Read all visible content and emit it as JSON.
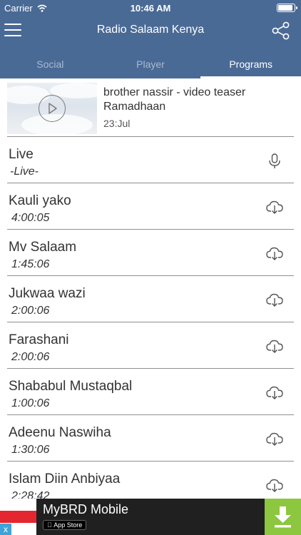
{
  "status_bar": {
    "carrier": "Carrier",
    "time": "10:46 AM"
  },
  "header": {
    "title": "Radio Salaam Kenya"
  },
  "tabs": [
    {
      "label": "Social",
      "active": false
    },
    {
      "label": "Player",
      "active": false
    },
    {
      "label": "Programs",
      "active": true
    }
  ],
  "featured": {
    "title": "brother nassir - video teaser Ramadhaan",
    "date": "23:Jul"
  },
  "programs": [
    {
      "title": "Live",
      "subtitle": "-Live-",
      "icon": "microphone-icon"
    },
    {
      "title": "Kauli yako",
      "subtitle": "4:00:05",
      "icon": "cloud-download-icon"
    },
    {
      "title": "Mv Salaam",
      "subtitle": "1:45:06",
      "icon": "cloud-download-icon"
    },
    {
      "title": "Jukwaa wazi",
      "subtitle": "2:00:06",
      "icon": "cloud-download-icon"
    },
    {
      "title": "Farashani",
      "subtitle": "2:00:06",
      "icon": "cloud-download-icon"
    },
    {
      "title": "Shababul Mustaqbal",
      "subtitle": "1:00:06",
      "icon": "cloud-download-icon"
    },
    {
      "title": "Adeenu Naswiha",
      "subtitle": "1:30:06",
      "icon": "cloud-download-icon"
    },
    {
      "title": "Islam Diin Anbiyaa",
      "subtitle": "2:28:42",
      "icon": "cloud-download-icon"
    }
  ],
  "ad": {
    "title": "MyBRD Mobile",
    "badge": "App Store",
    "close": "x"
  },
  "colors": {
    "header": "#4a6a96",
    "tab_inactive": "#a9b9d2",
    "ad_bg": "#202020",
    "ad_download": "#8dc63f",
    "ad_red": "#e3262f"
  }
}
